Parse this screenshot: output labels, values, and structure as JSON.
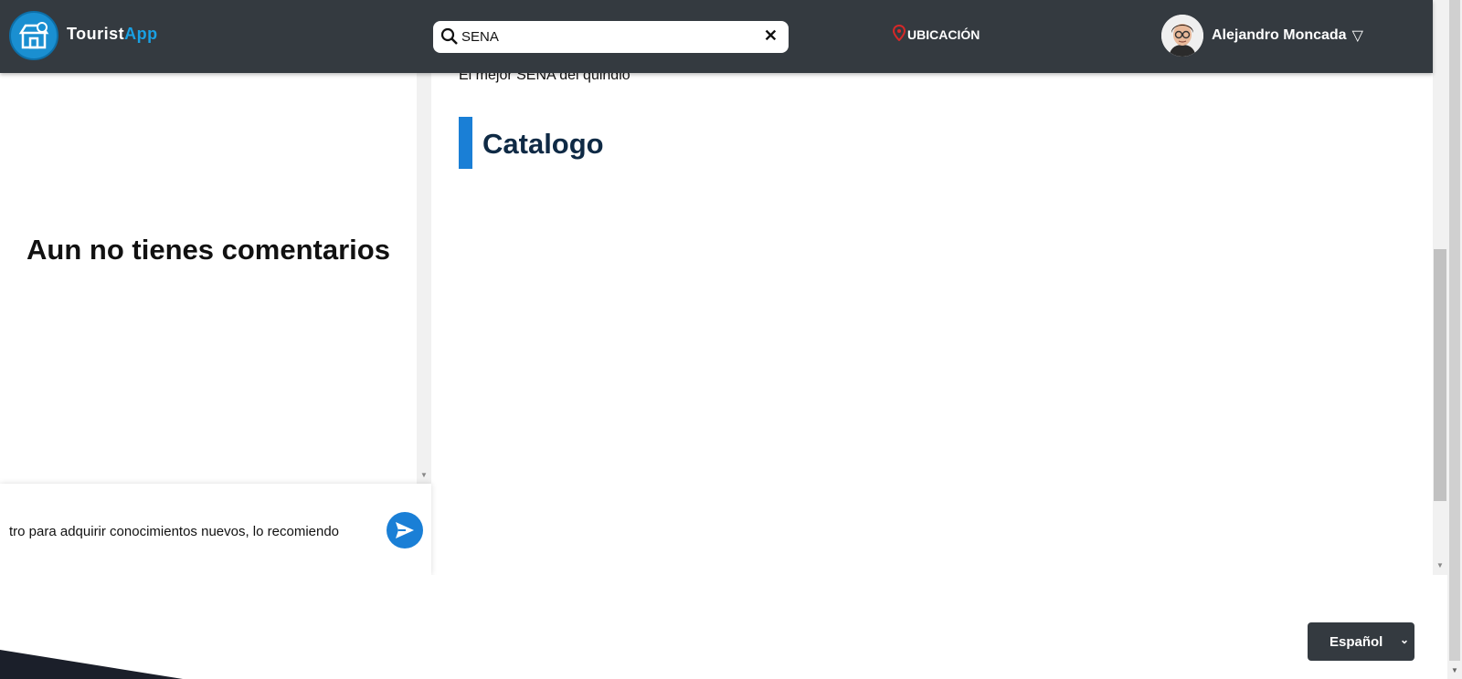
{
  "header": {
    "brand_part1": "Tourist",
    "brand_part2": "App",
    "search_value": "SENA",
    "location_label": "UBICACIÓN",
    "user_name": "Alejandro Moncada",
    "user_caret": "▽"
  },
  "comments": {
    "empty_message": "Aun no tienes comentarios",
    "input_value": "tro para adquirir conocimientos nuevos, lo recomiendo"
  },
  "main": {
    "description_text": "El mejor SENA del quindio",
    "catalog_heading": "Catalogo"
  },
  "footer": {
    "language_selected": "Español"
  },
  "colors": {
    "header_bg": "#343a40",
    "brand_accent": "#19a0e3",
    "primary_blue": "#1a7fd6",
    "heading_navy": "#0f2a45"
  }
}
